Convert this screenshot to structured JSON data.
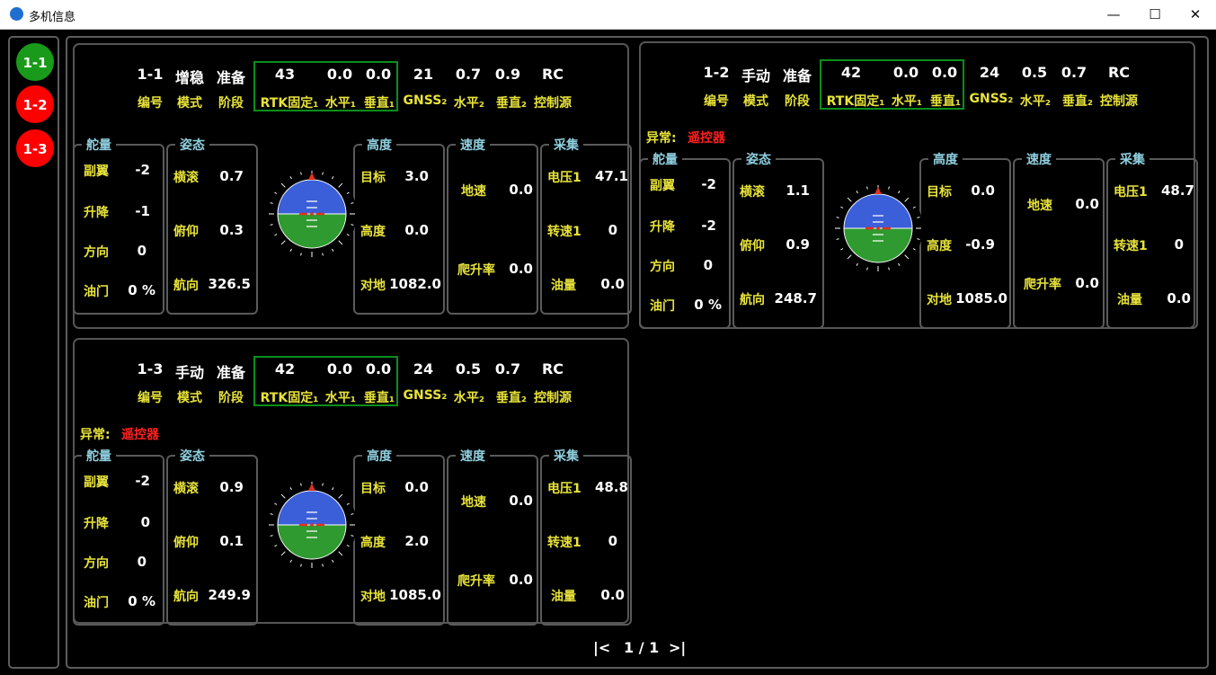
{
  "window": {
    "title": "多机信息",
    "minimize_icon": "minimize-icon",
    "maximize_icon": "maximize-icon",
    "close_icon": "close-icon",
    "min_glyph": "—",
    "max_glyph": "☐",
    "close_glyph": "✕"
  },
  "sidebar": {
    "items": [
      {
        "label": "1-1",
        "color": "#1a9a1a"
      },
      {
        "label": "1-2",
        "color": "#ff0000"
      },
      {
        "label": "1-3",
        "color": "#ff0000"
      }
    ]
  },
  "labels": {
    "id": "编号",
    "mode": "模式",
    "stage": "阶段",
    "rtk": "RTK固定₁",
    "h1": "水平₁",
    "v1": "垂直₁",
    "gnss": "GNSS₂",
    "h2": "水平₂",
    "v2": "垂直₂",
    "ctrl": "控制源",
    "warn": "异常:",
    "g_rudder": "舵量",
    "g_att": "姿态",
    "g_alt": "高度",
    "g_speed": "速度",
    "g_coll": "采集",
    "aileron": "副翼",
    "elevator": "升降",
    "direction": "方向",
    "throttle": "油门",
    "roll": "横滚",
    "pitch": "俯仰",
    "heading": "航向",
    "target": "目标",
    "altitude": "高度",
    "ground": "对地",
    "gspeed": "地速",
    "climb": "爬升率",
    "volt": "电压1",
    "rpm": "转速1",
    "fuel": "油量"
  },
  "cards": [
    {
      "id": "1-1",
      "mode": "增稳",
      "stage": "准备",
      "rtk": "43",
      "h1": "0.0",
      "v1": "0.0",
      "gnss": "21",
      "h2": "0.7",
      "v2": "0.9",
      "ctrl": "RC",
      "warn": "",
      "aileron": "-2",
      "elevator": "-1",
      "direction": "0",
      "throttle": "0 %",
      "roll": "0.7",
      "pitch": "0.3",
      "heading": "326.5",
      "target": "3.0",
      "altitude": "0.0",
      "ground": "1082.0",
      "gspeed": "0.0",
      "climb": "0.0",
      "volt": "47.1",
      "rpm": "0",
      "fuel": "0.0"
    },
    {
      "id": "1-2",
      "mode": "手动",
      "stage": "准备",
      "rtk": "42",
      "h1": "0.0",
      "v1": "0.0",
      "gnss": "24",
      "h2": "0.5",
      "v2": "0.7",
      "ctrl": "RC",
      "warn": "遥控器",
      "aileron": "-2",
      "elevator": "-2",
      "direction": "0",
      "throttle": "0 %",
      "roll": "1.1",
      "pitch": "0.9",
      "heading": "248.7",
      "target": "0.0",
      "altitude": "-0.9",
      "ground": "1085.0",
      "gspeed": "0.0",
      "climb": "0.0",
      "volt": "48.7",
      "rpm": "0",
      "fuel": "0.0"
    },
    {
      "id": "1-3",
      "mode": "手动",
      "stage": "准备",
      "rtk": "42",
      "h1": "0.0",
      "v1": "0.0",
      "gnss": "24",
      "h2": "0.5",
      "v2": "0.7",
      "ctrl": "RC",
      "warn": "遥控器",
      "aileron": "-2",
      "elevator": "0",
      "direction": "0",
      "throttle": "0 %",
      "roll": "0.9",
      "pitch": "0.1",
      "heading": "249.9",
      "target": "0.0",
      "altitude": "2.0",
      "ground": "1085.0",
      "gspeed": "0.0",
      "climb": "0.0",
      "volt": "48.8",
      "rpm": "0",
      "fuel": "0.0"
    }
  ],
  "pager": {
    "first": "|<",
    "page": "1 / 1",
    "last": ">|"
  },
  "colors": {
    "warn_label": "#e8e33a",
    "warn_value": "#ff2020",
    "sky": "#3b5fd8",
    "ground": "#2f9a2f"
  }
}
